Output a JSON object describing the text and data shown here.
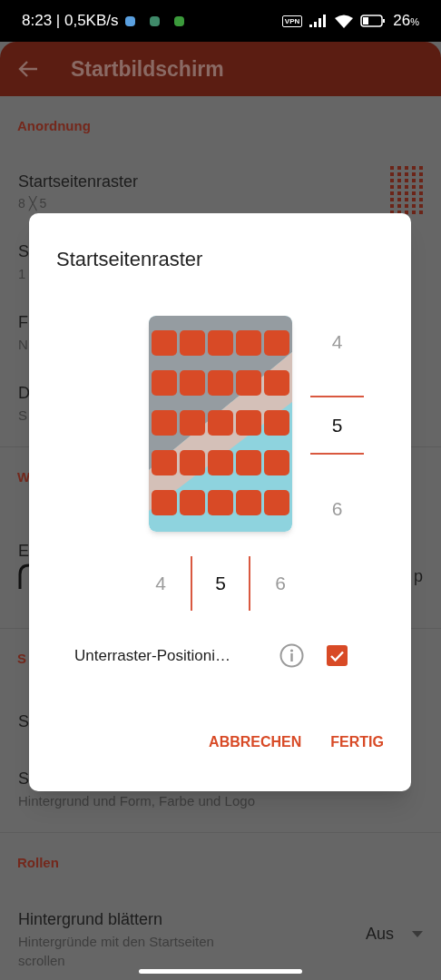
{
  "status_bar": {
    "time": "8:23 | 0,5KB/s",
    "vpn": "VPN",
    "battery": "26",
    "percent": "%"
  },
  "app_bar": {
    "title": "Startbildschirm"
  },
  "sections": [
    {
      "header": "Anordnung",
      "items": [
        {
          "kind": "grid_row",
          "title": "Startseitenraster",
          "subtitle": "8 ╳ 5"
        },
        {
          "kind": "row",
          "title": "S",
          "subtitle": "1"
        },
        {
          "kind": "row",
          "title": "F",
          "subtitle": "N"
        },
        {
          "kind": "row",
          "title": "D",
          "subtitle": "S"
        }
      ]
    },
    {
      "header": "W",
      "items": [
        {
          "kind": "arc_row",
          "title": "E",
          "trailing": "p"
        }
      ]
    },
    {
      "header": "S",
      "items": [
        {
          "kind": "row",
          "title": "S"
        },
        {
          "kind": "row",
          "title": "S",
          "subtitle": "Hintergrund und Form, Farbe und Logo"
        }
      ]
    },
    {
      "header": "Rollen",
      "items": [
        {
          "kind": "dropdown_row",
          "title": "Hintergrund blättern",
          "subtitle": "Hintergründe mit den Startseiten scrollen",
          "value": "Aus"
        }
      ]
    }
  ],
  "dialog": {
    "title": "Startseitenraster",
    "rows_picker": [
      {
        "value": "4",
        "selected": false
      },
      {
        "value": "5",
        "selected": true
      },
      {
        "value": "6",
        "selected": false
      }
    ],
    "columns_picker": [
      {
        "value": "4",
        "selected": false
      },
      {
        "value": "5",
        "selected": true
      },
      {
        "value": "6",
        "selected": false
      }
    ],
    "option": {
      "label": "Unterraster-Positioni…",
      "checked": true
    },
    "buttons": [
      "ABBRECHEN",
      "FERTIG"
    ]
  }
}
